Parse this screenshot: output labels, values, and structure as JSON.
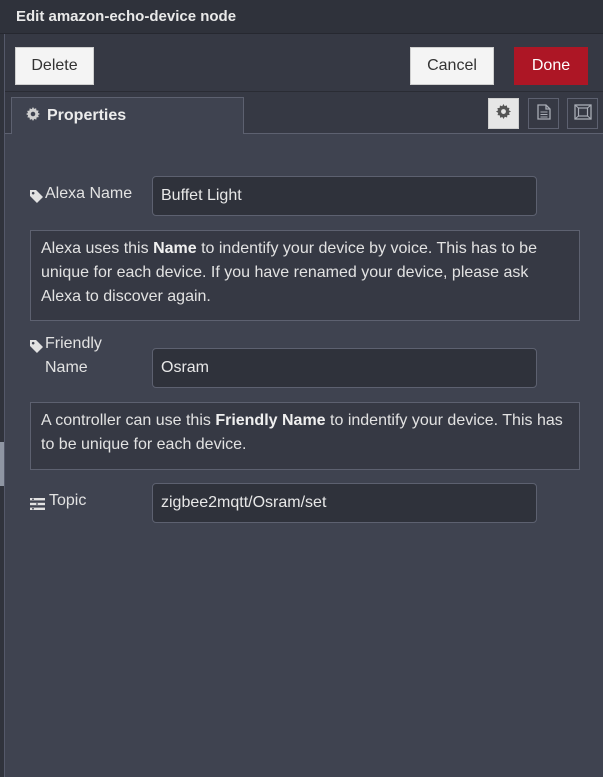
{
  "dialog": {
    "title": "Edit amazon-echo-device node"
  },
  "toolbar": {
    "delete_label": "Delete",
    "cancel_label": "Cancel",
    "done_label": "Done"
  },
  "tabs": {
    "properties_label": "Properties",
    "icons": [
      "gear-icon",
      "description-icon",
      "appearance-icon"
    ]
  },
  "form": {
    "alexa_name": {
      "label": "Alexa Name",
      "value": "Buffet Light",
      "tip_before": "Alexa uses this ",
      "tip_bold": "Name",
      "tip_after": " to indentify your device by voice. This has to be unique for each device. If you have renamed your device, please ask Alexa to discover again."
    },
    "friendly_name": {
      "label": "Friendly Name",
      "value": "Osram",
      "tip_before": "A controller can use this ",
      "tip_bold": "Friendly Name",
      "tip_after": " to indentify your device. This has to be unique for each device."
    },
    "topic": {
      "label": "Topic",
      "value": "zigbee2mqtt/Osram/set"
    }
  },
  "colors": {
    "background": "#3f4350",
    "done_button": "#ad1625"
  }
}
